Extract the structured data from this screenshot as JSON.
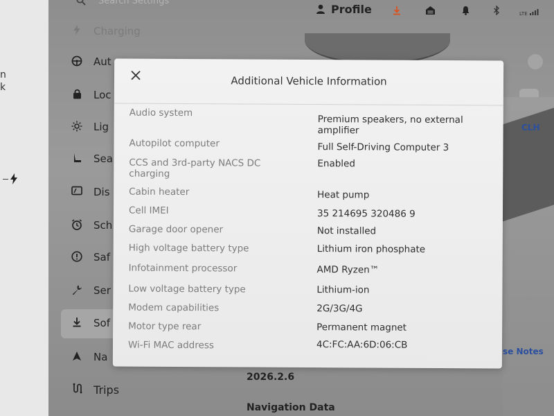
{
  "left_strip": {
    "fragments": [
      "n",
      "k"
    ],
    "bolt_icon": "lightning-icon"
  },
  "search": {
    "placeholder": "Search Settings",
    "icon": "search-icon"
  },
  "topbar": {
    "profile_label": "Profile",
    "icons": [
      "person-icon",
      "download-icon",
      "garage-icon",
      "bell-icon",
      "bluetooth-icon",
      "lte-signal-icon"
    ],
    "lte_label": "LTE",
    "download_color": "#d9531e"
  },
  "menu": {
    "items": [
      {
        "icon": "charging-icon",
        "label": "Charging",
        "dim": true
      },
      {
        "icon": "steering-wheel-icon",
        "label": "Aut"
      },
      {
        "icon": "lock-icon",
        "label": "Loc"
      },
      {
        "icon": "sun-icon",
        "label": "Lig"
      },
      {
        "icon": "seat-icon",
        "label": "Sea"
      },
      {
        "icon": "display-icon",
        "label": "Dis"
      },
      {
        "icon": "clock-icon",
        "label": "Sch"
      },
      {
        "icon": "warning-icon",
        "label": "Saf"
      },
      {
        "icon": "wrench-icon",
        "label": "Ser"
      },
      {
        "icon": "download-icon",
        "label": "Sof",
        "selected": true
      },
      {
        "icon": "navigation-icon",
        "label": "Na"
      }
    ],
    "trips_label": "Trips"
  },
  "software": {
    "version": "2026.2.6",
    "navigation_data_label": "Navigation Data",
    "release_notes_label": "se Notes",
    "driver_initials": "CLH"
  },
  "modal": {
    "title": "Additional Vehicle Information",
    "close_icon": "close-icon",
    "rows": [
      {
        "label": "Audio system",
        "value": "Premium speakers, no external amplifier"
      },
      {
        "label": "Autopilot computer",
        "value": "Full Self-Driving Computer 3"
      },
      {
        "label": "CCS and 3rd-party NACS DC charging",
        "value": "Enabled"
      },
      {
        "label": "Cabin heater",
        "value": "Heat pump"
      },
      {
        "label": "Cell IMEI",
        "value": "35 214695 320486 9"
      },
      {
        "label": "Garage door opener",
        "value": "Not installed"
      },
      {
        "label": "High voltage battery type",
        "value": "Lithium iron phosphate"
      },
      {
        "label": "Infotainment processor",
        "value": "AMD Ryzen™"
      },
      {
        "label": "Low voltage battery type",
        "value": "Lithium-ion"
      },
      {
        "label": "Modem capabilities",
        "value": "2G/3G/4G"
      },
      {
        "label": "Motor type rear",
        "value": "Permanent magnet"
      },
      {
        "label": "Wi-Fi MAC address",
        "value": "4C:FC:AA:6D:06:CB"
      }
    ]
  },
  "colors": {
    "link_blue": "#2c4f9e",
    "modal_bg": "#f0f0f0",
    "key_text": "#7c7c7c",
    "value_text": "#2e2e2e"
  }
}
